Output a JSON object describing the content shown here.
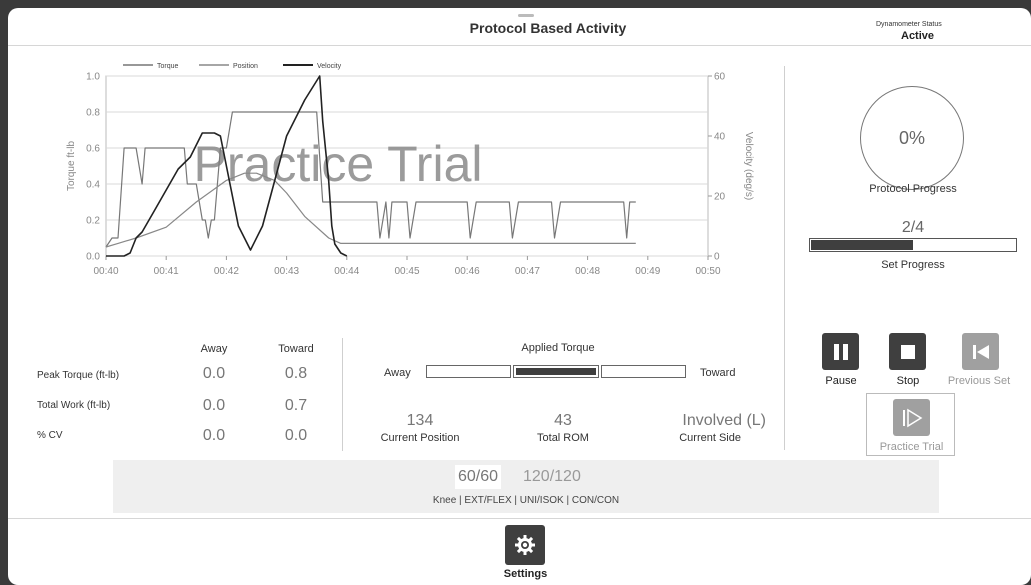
{
  "header": {
    "title": "Protocol Based Activity",
    "dynamometer_status_label": "Dynamometer Status",
    "dynamometer_status_value": "Active"
  },
  "chart_data": {
    "type": "line",
    "watermark": "Practice Trial",
    "legend": [
      "Torque",
      "Position",
      "Velocity"
    ],
    "legend_placement": "top-left",
    "xlabel": "",
    "ylabel": "Torque ft-lb",
    "y2label": "Velocity (deg/s)",
    "x_ticks": [
      "00:40",
      "00:41",
      "00:42",
      "00:43",
      "00:44",
      "00:45",
      "00:46",
      "00:47",
      "00:48",
      "00:49",
      "00:50"
    ],
    "y_ticks": [
      "0.0",
      "0.2",
      "0.4",
      "0.6",
      "0.8",
      "1.0"
    ],
    "y2_ticks": [
      "0",
      "20",
      "40",
      "60"
    ],
    "xlim_seconds": [
      40,
      50
    ],
    "ylim": [
      0,
      1.0
    ],
    "y2lim": [
      0,
      60
    ],
    "grid": true,
    "series": [
      {
        "name": "Torque",
        "x": [
          40.0,
          40.1,
          40.2,
          40.3,
          40.35,
          40.4,
          40.5,
          40.6,
          40.65,
          40.7,
          40.75,
          40.8,
          41.0,
          41.1,
          41.3,
          41.35,
          41.4,
          41.5,
          41.6,
          41.65,
          41.7,
          41.75,
          41.8,
          41.9,
          42.0,
          42.1,
          43.0,
          43.2,
          43.5,
          43.6,
          43.7,
          43.9,
          44.5,
          44.55,
          44.65,
          44.7,
          44.75,
          44.8,
          45.0,
          45.05,
          45.15,
          45.2,
          46.0,
          46.05,
          46.15,
          46.2,
          46.3,
          46.35,
          46.4,
          46.45,
          46.7,
          46.75,
          46.85,
          46.9,
          46.95,
          47.0,
          47.05,
          47.1,
          47.15,
          47.2,
          47.4,
          47.45,
          47.55,
          47.6,
          47.7,
          47.75,
          47.8,
          47.85,
          48.6,
          48.65,
          48.7,
          48.75,
          48.8
        ],
        "values": [
          0.05,
          0.1,
          0.1,
          0.6,
          0.6,
          0.6,
          0.6,
          0.4,
          0.6,
          0.6,
          0.6,
          0.6,
          0.6,
          0.6,
          0.6,
          0.4,
          0.4,
          0.4,
          0.2,
          0.2,
          0.1,
          0.2,
          0.2,
          0.6,
          0.6,
          0.8,
          0.8,
          0.8,
          0.8,
          0.3,
          0.3,
          0.3,
          0.3,
          0.1,
          0.3,
          0.1,
          0.3,
          0.3,
          0.3,
          0.1,
          0.3,
          0.3,
          0.3,
          0.1,
          0.3,
          0.3,
          0.3,
          0.3,
          0.3,
          0.3,
          0.3,
          0.1,
          0.3,
          0.3,
          0.3,
          0.3,
          0.3,
          0.3,
          0.3,
          0.3,
          0.3,
          0.1,
          0.3,
          0.3,
          0.3,
          0.3,
          0.3,
          0.3,
          0.3,
          0.1,
          0.3,
          0.3,
          0.3
        ]
      },
      {
        "name": "Position",
        "x": [
          40.0,
          40.2,
          40.5,
          41.0,
          41.5,
          42.0,
          42.3,
          42.5,
          42.8,
          43.0,
          43.3,
          43.7,
          43.9,
          44.2,
          45.0,
          48.8
        ],
        "values": [
          0.05,
          0.07,
          0.1,
          0.16,
          0.3,
          0.42,
          0.46,
          0.46,
          0.42,
          0.35,
          0.22,
          0.1,
          0.07,
          0.07,
          0.07,
          0.07
        ]
      },
      {
        "name": "Velocity",
        "x": [
          40.0,
          40.3,
          40.4,
          40.5,
          40.6,
          40.8,
          41.0,
          41.2,
          41.4,
          41.6,
          41.8,
          41.9,
          42.0,
          42.2,
          42.4,
          42.6,
          42.8,
          43.0,
          43.3,
          43.55,
          43.6,
          43.7,
          43.75,
          43.8,
          43.9,
          44.0
        ],
        "values": [
          0,
          0,
          1,
          6,
          8,
          15,
          22,
          29,
          33,
          41,
          41,
          40,
          30,
          10,
          2,
          10,
          25,
          40,
          52,
          60,
          45,
          25,
          10,
          4,
          1,
          0
        ]
      }
    ]
  },
  "progress": {
    "protocol_percent": 0,
    "protocol_percent_text": "0%",
    "protocol_label": "Protocol Progress",
    "set_text": "2/4",
    "set_fraction": 0.5,
    "set_label": "Set Progress"
  },
  "controls": {
    "pause": "Pause",
    "stop": "Stop",
    "previous_set": "Previous Set",
    "practice_trial": "Practice Trial"
  },
  "stats": {
    "col_away": "Away",
    "col_toward": "Toward",
    "rows": [
      {
        "label": "Peak Torque (ft-lb)",
        "away": "0.0",
        "toward": "0.8"
      },
      {
        "label": "Total Work (ft-lb)",
        "away": "0.0",
        "toward": "0.7"
      },
      {
        "label": "% CV",
        "away": "0.0",
        "toward": "0.0"
      }
    ]
  },
  "applied_torque": {
    "label": "Applied Torque",
    "away": "Away",
    "toward": "Toward"
  },
  "readouts": {
    "current_position_value": "134",
    "current_position_label": "Current Position",
    "total_rom_value": "43",
    "total_rom_label": "Total ROM",
    "current_side_value": "Involved (L)",
    "current_side_label": "Current Side"
  },
  "speeds": {
    "selected": "60/60",
    "other": "120/120",
    "details": "Knee | EXT/FLEX | UNI/ISOK | CON/CON"
  },
  "footer": {
    "settings": "Settings"
  },
  "colors": {
    "dark_button": "#3f3f3f",
    "disabled_button": "#a0a0a0",
    "torque_line": "#777777",
    "position_line": "#888888",
    "velocity_line": "#222222"
  }
}
